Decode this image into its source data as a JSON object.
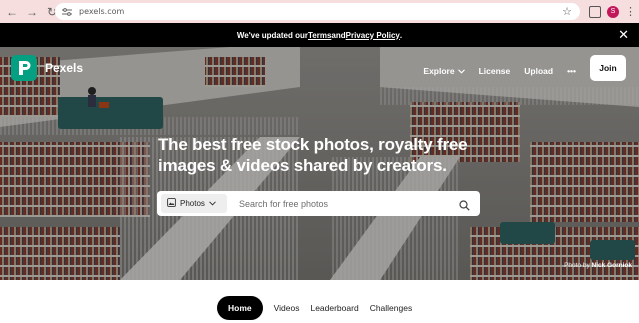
{
  "browser": {
    "url": "pexels.com",
    "profile_initial": "S"
  },
  "announcement": {
    "prefix": "We've updated our ",
    "terms": "Terms",
    "and": " and ",
    "privacy": "Privacy Policy",
    "suffix": "."
  },
  "brand": {
    "name": "Pexels",
    "color": "#05a081"
  },
  "nav": {
    "explore": "Explore",
    "license": "License",
    "upload": "Upload",
    "more": "•••",
    "join": "Join"
  },
  "hero": {
    "headline_line1": "The best free stock photos, royalty free",
    "headline_line2": "images & videos shared by creators.",
    "credit_prefix": "Photo by ",
    "credit_name": "Nick Gorniok"
  },
  "search": {
    "type_label": "Photos",
    "placeholder": "Search for free photos"
  },
  "tabs": [
    {
      "label": "Home",
      "active": true
    },
    {
      "label": "Videos",
      "active": false
    },
    {
      "label": "Leaderboard",
      "active": false
    },
    {
      "label": "Challenges",
      "active": false
    }
  ]
}
